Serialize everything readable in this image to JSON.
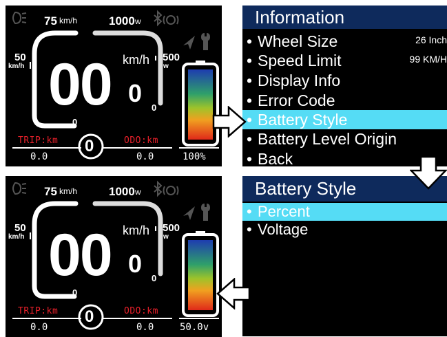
{
  "dash_top": {
    "speed_max": "75",
    "speed_max_unit": "km/h",
    "power_max": "1000",
    "power_max_unit": "w",
    "speed_mid": "50",
    "speed_mid_unit": "km/h",
    "power_mid": "500",
    "power_mid_unit": "w",
    "scale_zero_left": "0",
    "scale_zero_right": "0",
    "speed_unit": "km/h",
    "speed_digits": "00",
    "speed_decimal": "0",
    "trip_label": "TRIP:km",
    "odo_label": "ODO:km",
    "assist_level": "0",
    "trip_value": "0.0",
    "odo_value": "0.0",
    "battery_text": "100%"
  },
  "dash_bottom": {
    "speed_max": "75",
    "speed_max_unit": "km/h",
    "power_max": "1000",
    "power_max_unit": "w",
    "speed_mid": "50",
    "speed_mid_unit": "km/h",
    "power_mid": "500",
    "power_mid_unit": "w",
    "scale_zero_left": "0",
    "scale_zero_right": "0",
    "speed_unit": "km/h",
    "speed_digits": "00",
    "speed_decimal": "0",
    "trip_label": "TRIP:km",
    "odo_label": "ODO:km",
    "assist_level": "0",
    "trip_value": "0.0",
    "odo_value": "0.0",
    "battery_text": "50.0v"
  },
  "icons": [
    "headlight-icon",
    "bluetooth-icon",
    "brake-warning-icon",
    "navigation-arrow-icon",
    "wrench-icon",
    "battery-icon"
  ],
  "info_menu": {
    "title": "Information",
    "bullet": "•",
    "items": [
      {
        "label": "Wheel Size",
        "value": "26 Inch"
      },
      {
        "label": "Speed Limit",
        "value": "99 KM/H"
      },
      {
        "label": "Display Info"
      },
      {
        "label": "Error Code"
      },
      {
        "label": "Battery Style",
        "selected": true
      },
      {
        "label": "Battery Level Origin"
      },
      {
        "label": "Back"
      }
    ]
  },
  "battery_menu": {
    "title": "Battery Style",
    "items": [
      {
        "label": "Percent",
        "selected": true
      },
      {
        "label": "Voltage"
      }
    ]
  },
  "colors": {
    "menu_title_bg": "#0e2a5c",
    "menu_selected_bg": "#55dcf5",
    "trip_odo_label": "#e8202a"
  }
}
